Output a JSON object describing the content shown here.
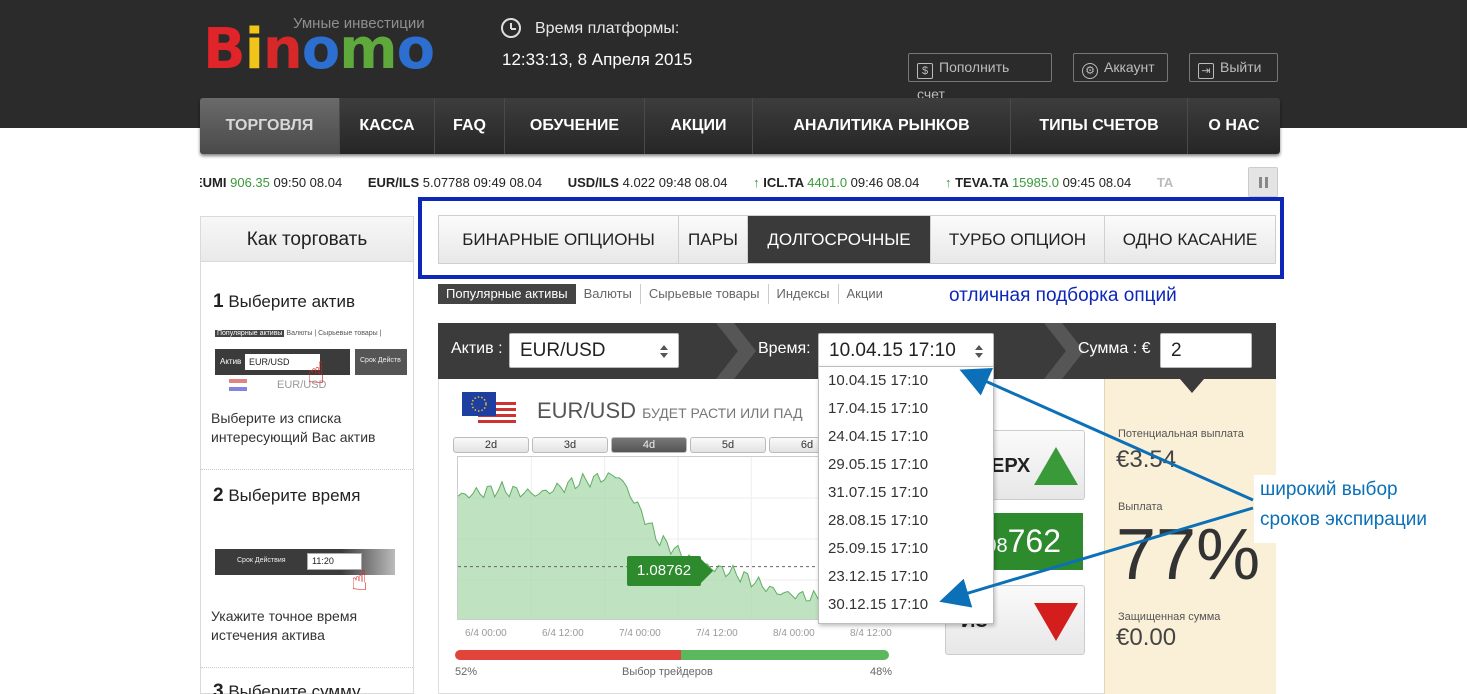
{
  "header": {
    "logo_tagline": "Умные инвестиции",
    "logo_text": "Binomo",
    "platform_label": "Время платформы:",
    "platform_time": "12:33:13, 8 Апреля 2015",
    "buttons": {
      "deposit": "Пополнить счет",
      "account": "Аккаунт",
      "exit": "Выйти"
    },
    "icons": {
      "deposit": "dollar-icon",
      "account": "gear-icon",
      "exit": "exit-icon",
      "clock": "clock-icon"
    }
  },
  "nav": {
    "items": [
      "ТОРГОВЛЯ",
      "КАССА",
      "FAQ",
      "ОБУЧЕНИЕ",
      "АКЦИИ",
      "АНАЛИТИКА РЫНКОВ",
      "ТИПЫ СЧЕТОВ",
      "О НАС"
    ],
    "active": "ТОРГОВЛЯ"
  },
  "ticker": [
    {
      "symbol": "EUMI",
      "value": "906.35",
      "time": "09:50 08.04",
      "up": false,
      "green": true
    },
    {
      "symbol": "EUR/ILS",
      "value": "5.07788",
      "time": "09:49 08.04",
      "up": false,
      "green": false
    },
    {
      "symbol": "USD/ILS",
      "value": "4.022",
      "time": "09:48 08.04",
      "up": false,
      "green": false
    },
    {
      "symbol": "ICL.TA",
      "value": "4401.0",
      "time": "09:46 08.04",
      "up": true,
      "green": true
    },
    {
      "symbol": "TEVA.TA",
      "value": "15985.0",
      "time": "09:45 08.04",
      "up": true,
      "green": true
    },
    {
      "symbol": "TA",
      "value": "",
      "time": "",
      "up": false,
      "green": false
    }
  ],
  "howto": {
    "title": "Как торговать",
    "steps": [
      {
        "num": "1",
        "title": "Выберите актив",
        "text1": "Выберите из списка",
        "text2": "интересующий Вас актив",
        "mini_tab1": "Популярные активы",
        "mini_tab2": "Валюты",
        "mini_tab3": "Сырьевые товары",
        "mini_label": "Актив",
        "mini_value": "EUR/USD",
        "mini_next": "Срок Действ",
        "mini_asset": "EUR/USD"
      },
      {
        "num": "2",
        "title": "Выберите время",
        "text1": "Укажите точное время",
        "text2": "истечения актива",
        "mini_label": "Срок Действия",
        "mini_value": "11:20"
      },
      {
        "num": "3",
        "title": "Выберите сумму"
      }
    ]
  },
  "option_tabs": [
    "БИНАРНЫЕ ОПЦИОНЫ",
    "ПАРЫ",
    "ДОЛГОСРОЧНЫЕ",
    "ТУРБО ОПЦИОН",
    "ОДНО КАСАНИЕ"
  ],
  "option_tab_active": "ДОЛГОСРОЧНЫЕ",
  "categories": [
    "Популярные активы",
    "Валюты",
    "Сырьевые товары",
    "Индексы",
    "Акции"
  ],
  "category_active": "Популярные активы",
  "annotations": {
    "top": "отличная подборка опций",
    "right_line1": "широкий выбор",
    "right_line2": "сроков экспирации"
  },
  "trade": {
    "asset_label": "Актив :",
    "asset_value": "EUR/USD",
    "time_label": "Время:",
    "time_value": "10.04.15 17:10",
    "sum_label": "Сумма : €",
    "sum_value": "2",
    "asset_title": "EUR/USD",
    "asset_subtitle": "БУДЕТ РАСТИ ИЛИ ПАД",
    "periods": [
      "2d",
      "3d",
      "4d",
      "5d",
      "6d"
    ],
    "period_active": "4d",
    "price_tag": "1.08762",
    "current_price_prefix": "08",
    "current_price_main": "762",
    "up_label": "ЕРХ",
    "down_label": "ИЗ",
    "x_labels": [
      "6/4 00:00",
      "6/4 12:00",
      "7/4 00:00",
      "7/4 12:00",
      "8/4 00:00",
      "8/4 12:00"
    ],
    "traders_left": "52%",
    "traders_right": "48%",
    "traders_label": "Выбор трейдеров",
    "traders_down_fraction": 0.52,
    "potential_label": "Потенциальная выплата",
    "potential_value": "€3.54",
    "payout_label": "Выплата",
    "payout_value": "77%",
    "protected_label": "Защищенная сумма",
    "protected_value": "€0.00"
  },
  "expiry_options": [
    "10.04.15 17:10",
    "17.04.15 17:10",
    "24.04.15 17:10",
    "29.05.15 17:10",
    "31.07.15 17:10",
    "28.08.15 17:10",
    "25.09.15 17:10",
    "23.12.15 17:10",
    "30.12.15 17:10"
  ],
  "chart_data": {
    "type": "area",
    "x": [
      "5/4 12:00",
      "6/4 00:00",
      "6/4 06:00",
      "6/4 12:00",
      "6/4 18:00",
      "7/4 00:00",
      "7/4 06:00",
      "7/4 12:00",
      "7/4 18:00",
      "8/4 00:00",
      "8/4 06:00",
      "8/4 09:00"
    ],
    "values": [
      1.0975,
      1.0985,
      1.0978,
      1.0995,
      1.1005,
      1.0915,
      1.088,
      1.0866,
      1.084,
      1.0832,
      1.086,
      1.0876
    ],
    "current_value": 1.08762
  },
  "colors": {
    "accent_blue": "#0d27b8",
    "up_green": "#3a9a3a",
    "down_red": "#d41e1e",
    "annotation_blue": "#0b70b8"
  }
}
